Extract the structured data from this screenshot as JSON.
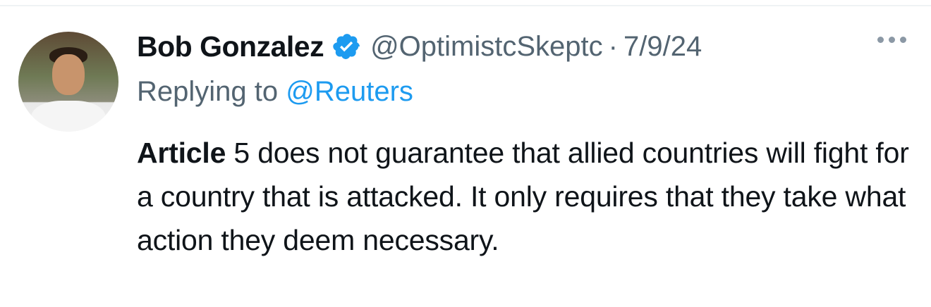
{
  "tweet": {
    "author_name": "Bob Gonzalez",
    "handle": "@OptimistcSkeptc",
    "separator": "·",
    "date": "7/9/24",
    "reply_prefix": "Replying to",
    "reply_to": "@Reuters",
    "text_bold": "Article",
    "text_rest": " 5 does not guarantee that allied countries will fight for a country that is attacked. It only requires that they take what action they deem necessary."
  },
  "colors": {
    "verified_badge": "#1d9bf0",
    "link": "#1d9bf0",
    "secondary_text": "#536471"
  },
  "icons": {
    "verified": "verified-badge-icon",
    "more": "more-options-icon"
  }
}
